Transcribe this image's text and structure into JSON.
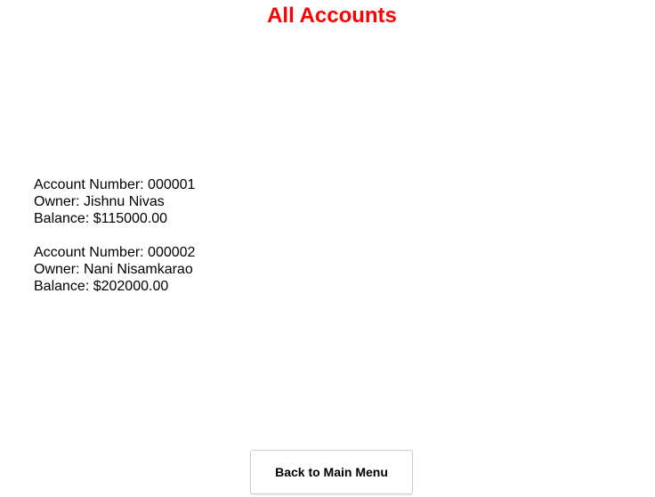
{
  "page": {
    "title": "All Accounts",
    "title_color": "#ff0000"
  },
  "accounts": [
    {
      "number_label": "Account Number: 000001",
      "owner_label": "Owner: Jishnu Nivas",
      "balance_label": "Balance: $115000.00"
    },
    {
      "number_label": "Account Number: 000002",
      "owner_label": "Owner: Nani Nisamkarao",
      "balance_label": "Balance: $202000.00"
    }
  ],
  "actions": {
    "back_label": "Back to Main Menu"
  }
}
